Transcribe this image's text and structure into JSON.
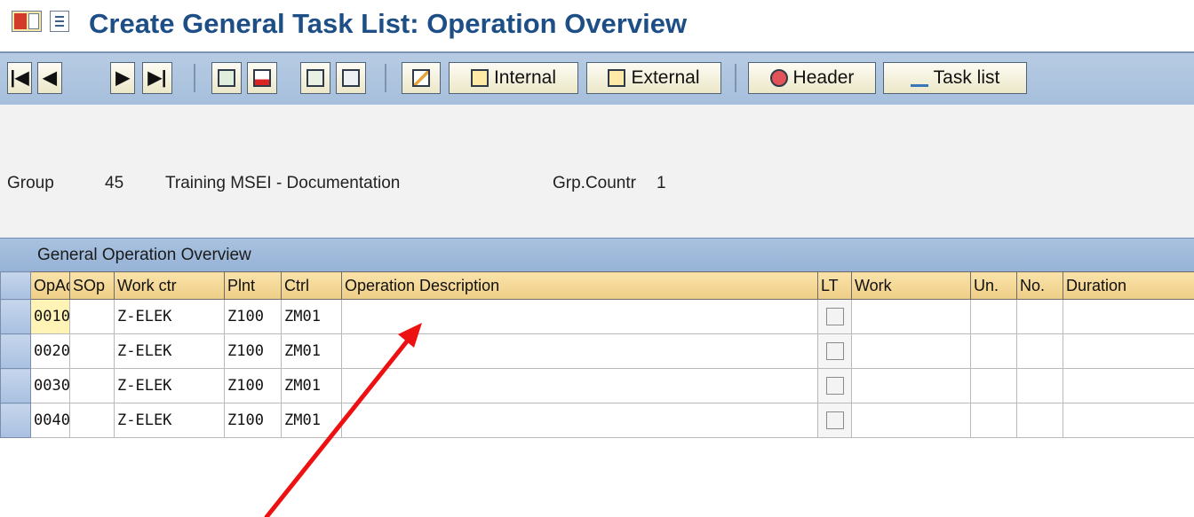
{
  "window": {
    "title": "Create General Task List: Operation Overview"
  },
  "toolbar": {
    "internal_label": "Internal",
    "external_label": "External",
    "header_label": "Header",
    "tasklist_label": "Task list"
  },
  "header": {
    "group_label": "Group",
    "group_value": "45",
    "group_desc": "Training MSEI - Documentation",
    "counter_label": "Grp.Countr",
    "counter_value": "1"
  },
  "table": {
    "title": "General Operation Overview",
    "columns": [
      "OpAc",
      "SOp",
      "Work ctr",
      "Plnt",
      "Ctrl",
      "Operation Description",
      "LT",
      "Work",
      "Un.",
      "No.",
      "Duration"
    ],
    "rows": [
      {
        "opac": "0010",
        "sop": "",
        "workctr": "Z-ELEK",
        "plnt": "Z100",
        "ctrl": "ZM01",
        "desc": "",
        "work": "",
        "un": "",
        "no": "",
        "duration": ""
      },
      {
        "opac": "0020",
        "sop": "",
        "workctr": "Z-ELEK",
        "plnt": "Z100",
        "ctrl": "ZM01",
        "desc": "",
        "work": "",
        "un": "",
        "no": "",
        "duration": ""
      },
      {
        "opac": "0030",
        "sop": "",
        "workctr": "Z-ELEK",
        "plnt": "Z100",
        "ctrl": "ZM01",
        "desc": "",
        "work": "",
        "un": "",
        "no": "",
        "duration": ""
      },
      {
        "opac": "0040",
        "sop": "",
        "workctr": "Z-ELEK",
        "plnt": "Z100",
        "ctrl": "ZM01",
        "desc": "",
        "work": "",
        "un": "",
        "no": "",
        "duration": ""
      }
    ]
  },
  "colors": {
    "title": "#1d4f86",
    "annotation_arrow": "#ee1111"
  },
  "icons": {
    "sap_logo": "sap-logo-icon",
    "menu": "menu-icon",
    "first": "first-page-icon",
    "prev": "previous-page-icon",
    "next": "next-page-icon",
    "last": "last-page-icon",
    "select_all": "select-all-icon",
    "deselect_all": "deselect-all-icon",
    "select_block": "select-block-icon",
    "deselect_block": "deselect-block-icon",
    "edit": "edit-icon",
    "internal": "internal-processing-icon",
    "external": "external-processing-icon",
    "header": "header-icon",
    "tasklist": "task-list-icon"
  }
}
